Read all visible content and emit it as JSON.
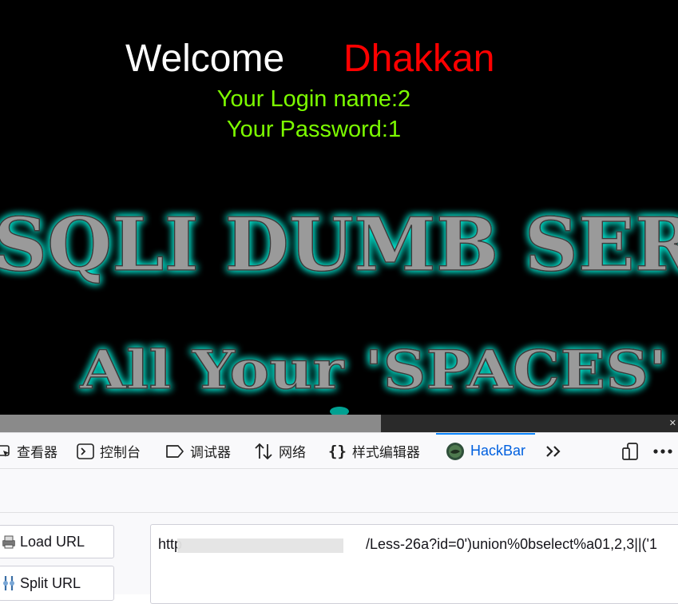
{
  "page": {
    "welcome": "Welcome",
    "username": "Dhakkan",
    "login_name_line": "Your Login name:2",
    "password_line": "Your Password:1",
    "banner_line1": "SQLI DUMB SER",
    "banner_line2": "All Your 'SPACES'",
    "colors": {
      "background": "#000000",
      "welcome": "#ffffff",
      "username": "#ff0000",
      "info": "#7cfc00",
      "banner_glow": "#00e5d0"
    }
  },
  "devtools": {
    "tabs": [
      {
        "label": "查看器",
        "icon": "inspector-icon"
      },
      {
        "label": "控制台",
        "icon": "console-icon"
      },
      {
        "label": "调试器",
        "icon": "debugger-icon"
      },
      {
        "label": "网络",
        "icon": "network-icon"
      },
      {
        "label": "样式编辑器",
        "icon": "style-editor-icon"
      },
      {
        "label": "HackBar",
        "icon": "hackbar-icon",
        "active": true
      }
    ],
    "overflow_icon": "chevron-double-right-icon",
    "responsive_icon": "responsive-design-icon",
    "menu_icon": "more-menu-icon",
    "accent": "#0060df"
  },
  "hackbar": {
    "load_url": "Load URL",
    "split_url": "Split URL",
    "url_start": "http",
    "url_end": "/Less-26a?id=0')union%0bselect%a01,2,3||('1"
  }
}
